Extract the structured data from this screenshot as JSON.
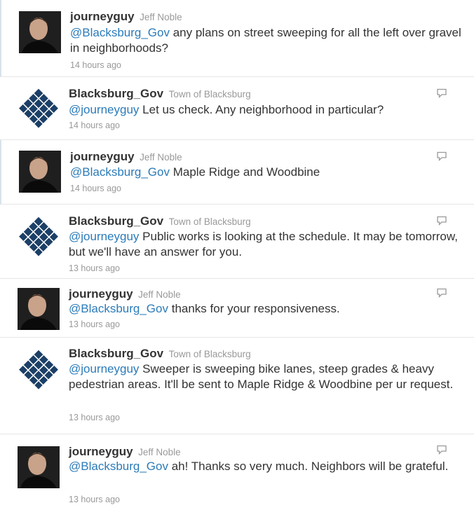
{
  "tweets": [
    {
      "user": "journeyguy",
      "full": "Jeff Noble",
      "mention": "@Blacksburg_Gov",
      "text": " any plans on street sweeping for all the left over gravel in neighborhoods?",
      "time": "14 hours ago"
    },
    {
      "user": "Blacksburg_Gov",
      "full": "Town of Blacksburg",
      "mention": "@journeyguy",
      "text": " Let us check. Any neighborhood in particular?",
      "time": "14 hours ago"
    },
    {
      "user": "journeyguy",
      "full": "Jeff Noble",
      "mention": "@Blacksburg_Gov",
      "text": " Maple Ridge and Woodbine",
      "time": "14 hours ago"
    },
    {
      "user": "Blacksburg_Gov",
      "full": "Town of Blacksburg",
      "mention": "@journeyguy",
      "text": " Public works is looking at the schedule. It may be tomorrow, but we'll have an answer for you.",
      "time": "13 hours ago"
    },
    {
      "user": "journeyguy",
      "full": "Jeff Noble",
      "mention": "@Blacksburg_Gov",
      "text": " thanks for your responsiveness.",
      "time": "13 hours ago"
    },
    {
      "user": "Blacksburg_Gov",
      "full": "Town of Blacksburg",
      "mention": "@journeyguy",
      "text": " Sweeper is sweeping bike lanes, steep grades & heavy pedestrian areas. It'll be sent to Maple Ridge & Woodbine per ur request.",
      "time": "13 hours ago"
    },
    {
      "user": "journeyguy",
      "full": "Jeff Noble",
      "mention": "@Blacksburg_Gov",
      "text": " ah! Thanks so very much. Neighbors will be grateful.",
      "time": "13 hours ago"
    }
  ],
  "icons": {
    "avatar_person": "person-avatar-icon",
    "avatar_logo": "blacksburg-logo-icon",
    "reply": "reply-icon"
  },
  "colors": {
    "mention": "#2b7bb9",
    "username": "#333333",
    "meta": "#999999",
    "logo": "#1b3f66"
  }
}
